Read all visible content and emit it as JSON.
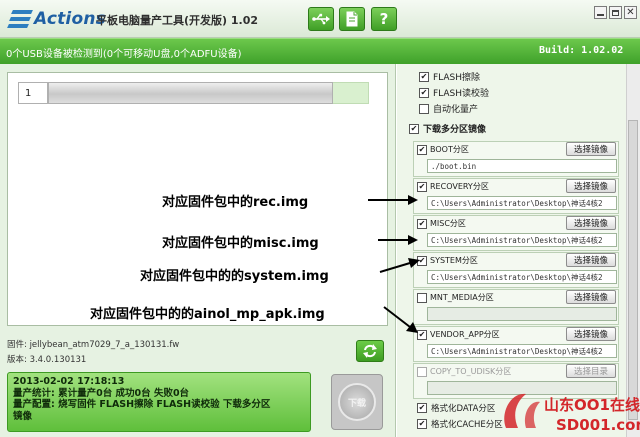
{
  "app": {
    "logo_text": "Actions",
    "title": "平板电脑量产工具(开发版) 1.02"
  },
  "status": {
    "device_text": "0个USB设备被检测到(0个可移动U盘,0个ADFU设备)",
    "build_text": "Build: 1.02.02"
  },
  "device": {
    "slot_number": "1",
    "progress": 0
  },
  "info": {
    "firmware_line": "固件: jellybean_atm7029_7_a_130131.fw",
    "version_line": "版本: 3.4.0.130131"
  },
  "log": {
    "lines": [
      "2013-02-02 17:18:13",
      "量产统计: 累计量产0台 成功0台 失败0台",
      "量产配置: 烧写固件 FLASH擦除 FLASH读校验 下载多分区",
      "镜像"
    ]
  },
  "download_button_label": "下载",
  "options": [
    {
      "label": "FLASH擦除",
      "checked": true
    },
    {
      "label": "FLASH读校验",
      "checked": true
    },
    {
      "label": "自动化量产",
      "checked": false
    }
  ],
  "multi_partition": {
    "label": "下载多分区镜像",
    "checked": true
  },
  "partitions": [
    {
      "label": "BOOT分区",
      "checked": true,
      "path": "./boot.bin",
      "button": "选择镜像",
      "enabled": true
    },
    {
      "label": "RECOVERY分区",
      "checked": true,
      "path": "C:\\Users\\Administrator\\Desktop\\神话4核2",
      "button": "选择镜像",
      "enabled": true
    },
    {
      "label": "MISC分区",
      "checked": true,
      "path": "C:\\Users\\Administrator\\Desktop\\神话4核2",
      "button": "选择镜像",
      "enabled": true
    },
    {
      "label": "SYSTEM分区",
      "checked": true,
      "path": "C:\\Users\\Administrator\\Desktop\\神话4核2",
      "button": "选择镜像",
      "enabled": true
    },
    {
      "label": "MNT_MEDIA分区",
      "checked": false,
      "path": "",
      "button": "选择镜像",
      "enabled": true
    },
    {
      "label": "VENDOR_APP分区",
      "checked": true,
      "path": "C:\\Users\\Administrator\\Desktop\\神话4核2",
      "button": "选择镜像",
      "enabled": true
    },
    {
      "label": "COPY_TO_UDISK分区",
      "checked": false,
      "path": "",
      "button": "选择目录",
      "enabled": false
    }
  ],
  "bottom_options": [
    {
      "label": "格式化DATA分区",
      "checked": true
    },
    {
      "label": "格式化CACHE分区",
      "checked": true
    }
  ],
  "annotations": [
    "对应固件包中的rec.img",
    "对应固件包中的misc.img",
    "对应固件包中的的system.img",
    "对应固件包中的的ainol_mp_apk.img"
  ],
  "watermark": {
    "brand": "山东OO1在线",
    "domain": "SD001.com"
  },
  "colors": {
    "accent_green": "#3fa12a",
    "log_green": "#5fbf3b",
    "logo_blue": "#1f5fa3"
  },
  "icons": [
    "usb-icon",
    "document-icon",
    "help-icon",
    "refresh-icon",
    "download-icon"
  ]
}
